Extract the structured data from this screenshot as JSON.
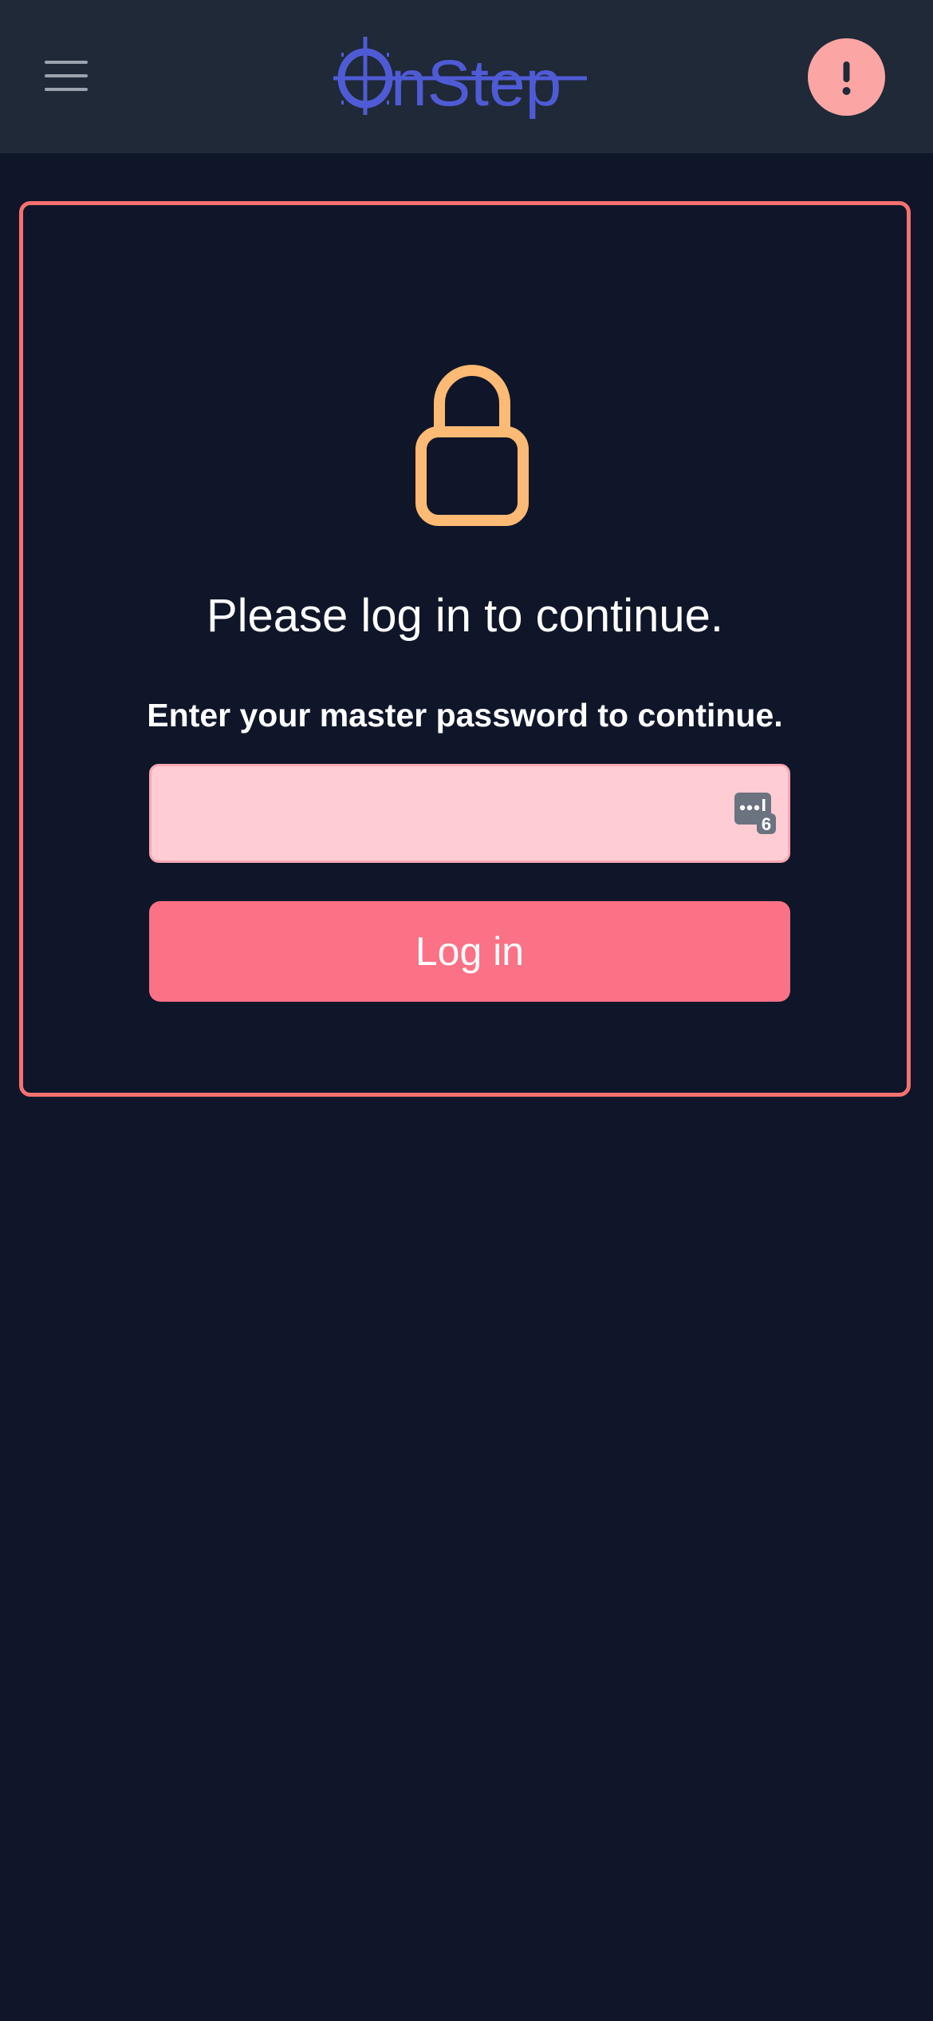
{
  "header": {
    "logo_text": "OnStep",
    "menu_icon": "hamburger-menu-icon",
    "alert_icon": "exclamation-icon"
  },
  "login": {
    "lock_icon": "lock-icon",
    "heading": "Please log in to continue.",
    "prompt": "Enter your master password to continue.",
    "password_value": "",
    "password_placeholder": "",
    "password_manager_icon": "password-manager-icon",
    "password_manager_badge": "6",
    "button_label": "Log in"
  },
  "colors": {
    "background": "#0f1629",
    "header": "#1f2937",
    "card_border": "#f87171",
    "lock": "#fdba74",
    "input_bg": "#fecdd3",
    "button_bg": "#fb7185",
    "alert_bg": "#fca5a5",
    "logo": "#4f5bd5"
  }
}
